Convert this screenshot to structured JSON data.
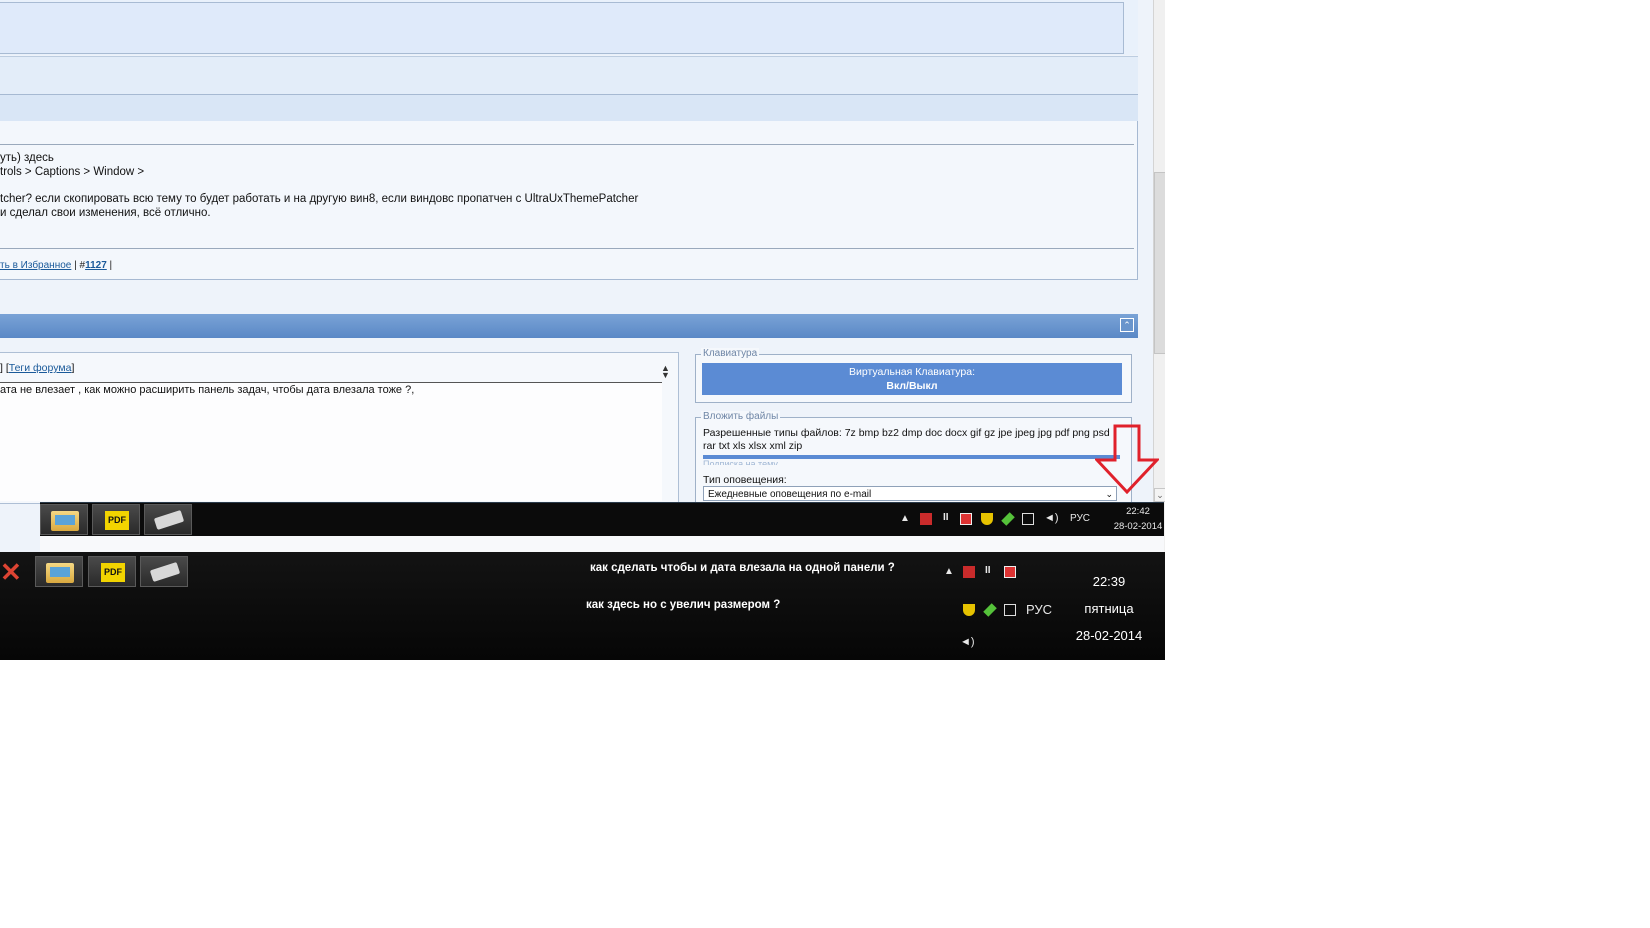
{
  "post": {
    "line1": "уть) здесь",
    "line2": "trols > Captions > Window >",
    "line3": "tcher? если скопировать всю тему то будет работать и на другую вин8, если виндовс пропатчен с UltraUxThemePatcher",
    "line4": "и сделал свои изменения, всё отлично.",
    "link_favorites": "ть в Избранное",
    "sep1": " | #",
    "post_number": "1127",
    "sep2": " |"
  },
  "reply": {
    "tags_prefix": "] [",
    "tags_link": "Теги форума",
    "tags_suffix": "]",
    "text": "ата не влезает , как можно расширить панель задач, чтобы дата влезала тоже ?,"
  },
  "keyboard": {
    "legend": "Клавиатура",
    "button_line1": "Виртуальная Клавиатура:",
    "button_line2": "Вкл/Выкл"
  },
  "attach": {
    "legend": "Вложить файлы",
    "allowed_types": "Разрешенные типы файлов: 7z bmp bz2 dmp doc docx gif gz jpe jpeg jpg pdf png psd rar txt xls xlsx xml zip",
    "hidden_legend": "Подписка на тему"
  },
  "notify": {
    "label": "Тип оповещения:",
    "selected": "Ежедневные оповещения по e-mail"
  },
  "taskbar_small": {
    "lang": "РУС",
    "time": "22:42",
    "date": "28-02-2014"
  },
  "taskbar_large": {
    "lang": "РУС",
    "time": "22:39",
    "day": "пятница",
    "date": "28-02-2014"
  },
  "annotations": {
    "q1": "как сделать чтобы и дата влезала на одной панели ?",
    "q2": "как здесь но с увелич размером ?"
  },
  "icons": {
    "arrow_color": "#e0212b"
  }
}
